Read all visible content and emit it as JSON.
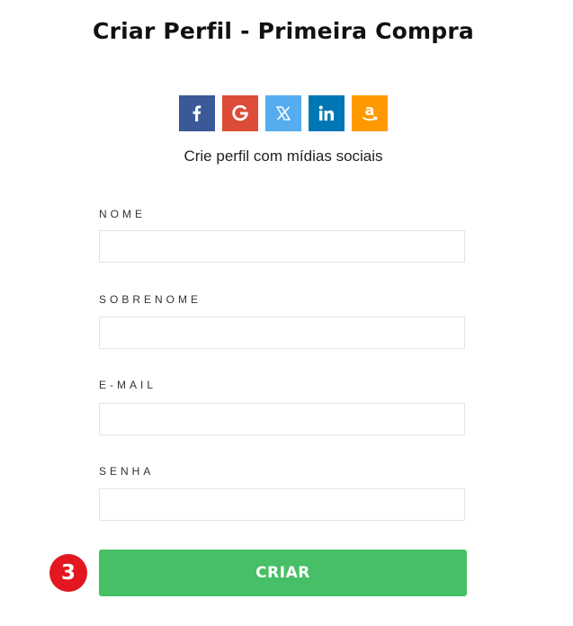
{
  "page": {
    "title": "Criar Perfil - Primeira Compra"
  },
  "social": {
    "subtitle": "Crie perfil com mídias sociais",
    "buttons": [
      {
        "name": "facebook",
        "icon": "facebook-icon",
        "color": "#3b5998"
      },
      {
        "name": "google",
        "icon": "google-icon",
        "color": "#dd4b39"
      },
      {
        "name": "x",
        "icon": "x-icon",
        "color": "#55acee"
      },
      {
        "name": "linkedin",
        "icon": "linkedin-icon",
        "color": "#0077b5"
      },
      {
        "name": "amazon",
        "icon": "amazon-icon",
        "color": "#ff9900"
      }
    ]
  },
  "form": {
    "nome": {
      "label": "NOME",
      "value": "",
      "placeholder": ""
    },
    "sobrenome": {
      "label": "SOBRENOME",
      "value": "",
      "placeholder": ""
    },
    "email": {
      "label": "E-MAIL",
      "value": "",
      "placeholder": ""
    },
    "senha": {
      "label": "SENHA",
      "value": "",
      "placeholder": ""
    },
    "submit_label": "CRIAR",
    "submit_color": "#47bf66"
  },
  "annotation": {
    "step": "3",
    "color": "#e2171f"
  }
}
